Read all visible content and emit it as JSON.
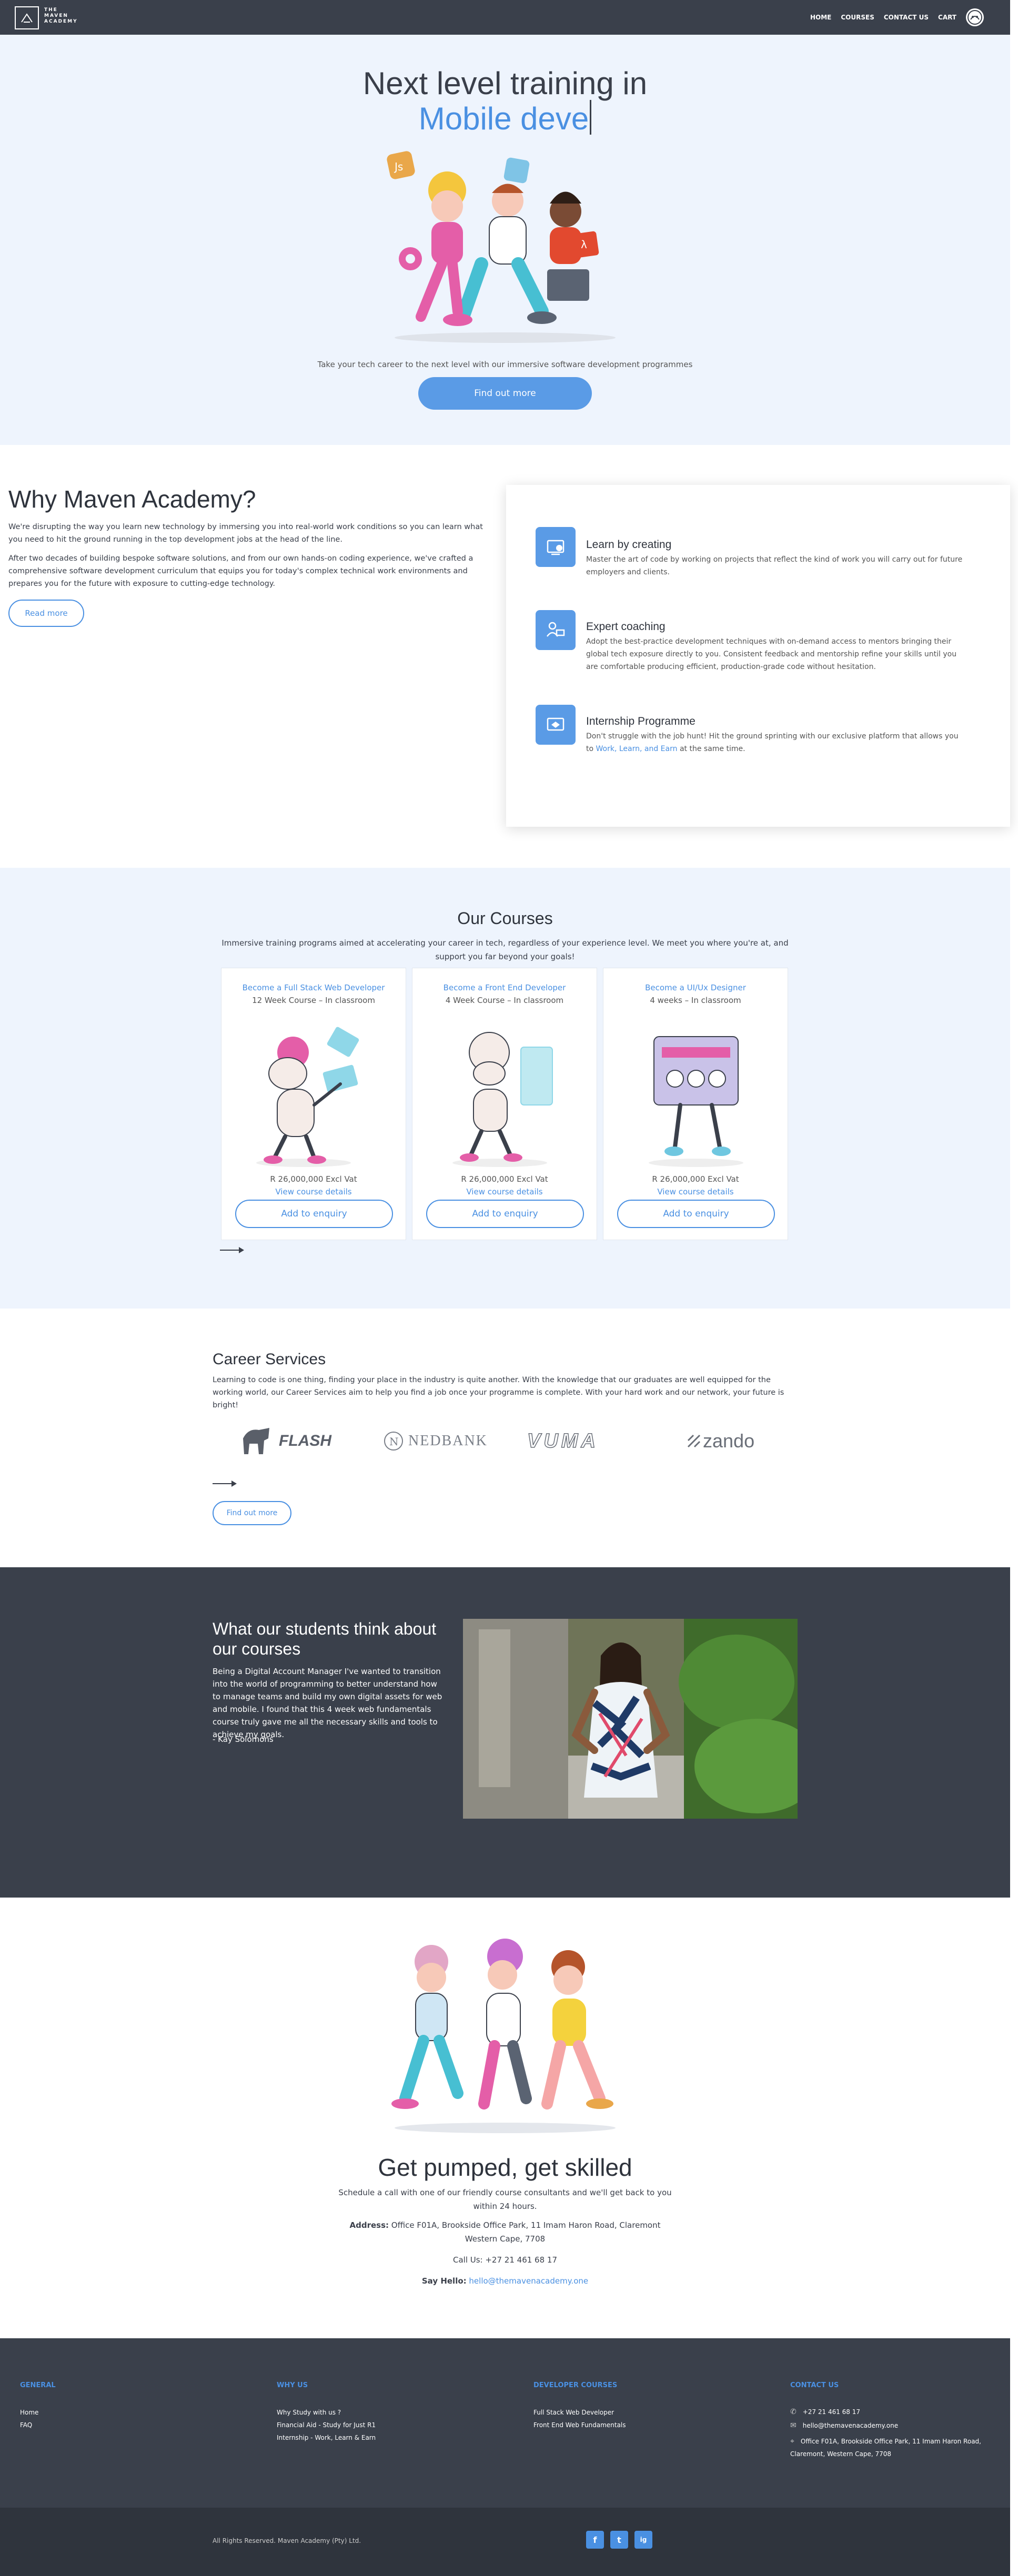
{
  "nav": {
    "logo_lines": [
      "THE",
      "MAVEN",
      "ACADEMY"
    ],
    "links": [
      "HOME",
      "COURSES",
      "CONTACT US",
      "CART"
    ]
  },
  "hero": {
    "title_line1": "Next level training in",
    "title_line2": "Mobile deve",
    "subtitle": "Take your tech career to the next level with our immersive software development programmes",
    "cta": "Find out more"
  },
  "why": {
    "title": "Why Maven Academy?",
    "para1": "We're disrupting the way you learn new technology by immersing you into real-world work conditions so you can learn what you need to hit the ground running in the top development jobs at the head of the line.",
    "para2": "After two decades of building bespoke software solutions, and from our own hands-on coding experience, we've crafted a comprehensive software development curriculum that equips you for today's complex technical work environments and prepares you for the future with exposure to cutting-edge technology.",
    "read_more": "Read more",
    "features": [
      {
        "title": "Learn by creating",
        "desc": "Master the art of code by working on projects that reflect the kind of work you will carry out for future employers and clients."
      },
      {
        "title": "Expert coaching",
        "desc": "Adopt the best-practice development techniques with on-demand access to mentors bringing their global tech exposure directly to you. Consistent feedback and mentorship refine your skills until you are comfortable producing efficient, production-grade code without hesitation."
      },
      {
        "title": "Internship Programme",
        "desc_pre": "Don't struggle with the job hunt! Hit the ground sprinting with our exclusive platform that allows you to ",
        "desc_link": "Work, Learn, and Earn",
        "desc_post": " at the same time."
      }
    ]
  },
  "courses": {
    "title": "Our Courses",
    "subtitle": "Immersive training programs aimed at accelerating your career in tech, regardless of your experience level. We meet you where you're at, and support you far beyond your goals!",
    "items": [
      {
        "title": "Become a Full Stack Web Developer",
        "meta": "12 Week Course – In classroom",
        "price": "R 26,000,000 Excl Vat",
        "details": "View course details",
        "button": "Add to enquiry"
      },
      {
        "title": "Become a Front End Developer",
        "meta": "4 Week Course – In classroom",
        "price": "R 26,000,000 Excl Vat",
        "details": "View course details",
        "button": "Add to enquiry"
      },
      {
        "title": "Become a UI/Ux Designer",
        "meta": "4 weeks – In classroom",
        "price": "R 26,000,000 Excl Vat",
        "details": "View course details",
        "button": "Add to enquiry"
      }
    ]
  },
  "career": {
    "title": "Career Services",
    "subtitle": "Learning to code is one thing, finding your place in the industry is quite another. With the knowledge that our graduates are well equipped for the working world, our Career Services aim to help you find a job once your programme is complete. With your hard work and our network, your future is bright!",
    "partners": [
      "FLASH",
      "NEDBANK",
      "VUMA",
      "zando"
    ],
    "cta": "Find out more"
  },
  "testimonial": {
    "title": "What our students think about our courses",
    "body": "Being a Digital Account Manager I've wanted to transition into the world of programming to better understand how to manage teams and build my own digital assets for web and mobile. I found that this 4 week web fundamentals course truly gave me all the necessary skills and tools to achieve my goals.",
    "author": "- Kay Solomons"
  },
  "cta": {
    "title": "Get pumped, get skilled",
    "text": "Schedule a call with one of our friendly course consultants and we'll get back to you within 24 hours.",
    "address_label": "Address:",
    "address": "Office F01A, Brookside Office Park, 11 Imam Haron Road, Claremont Western Cape, 7708",
    "call": "Call Us: +27 21 461 68 17",
    "hello_label": "Say Hello:",
    "hello_email": "hello@themavenacademy.one"
  },
  "footer": {
    "general": {
      "title": "GENERAL",
      "items": [
        "Home",
        "FAQ"
      ]
    },
    "why": {
      "title": "WHY US",
      "items": [
        "Why Study with us ?",
        "Financial Aid - Study for Just R1",
        "Internship - Work, Learn & Earn"
      ]
    },
    "dev": {
      "title": "DEVELOPER COURSES",
      "items": [
        "Full Stack Web Developer",
        "Front End Web Fundamentals"
      ]
    },
    "contact": {
      "title": "CONTACT US",
      "items": [
        "+27 21 461 68 17",
        "hello@themavenacademy.one",
        "Office F01A, Brookside Office Park, 11 Imam Haron Road, Claremont, Western Cape, 7708"
      ]
    },
    "copyright": "All Rights Reserved. Maven Academy (Pty) Ltd.",
    "social": [
      "f",
      "t",
      "ig"
    ]
  },
  "colors": {
    "nav": "#3a404b",
    "accent": "#4a90e2",
    "hero_bg": "#eef4fd",
    "button": "#5a9be6"
  }
}
